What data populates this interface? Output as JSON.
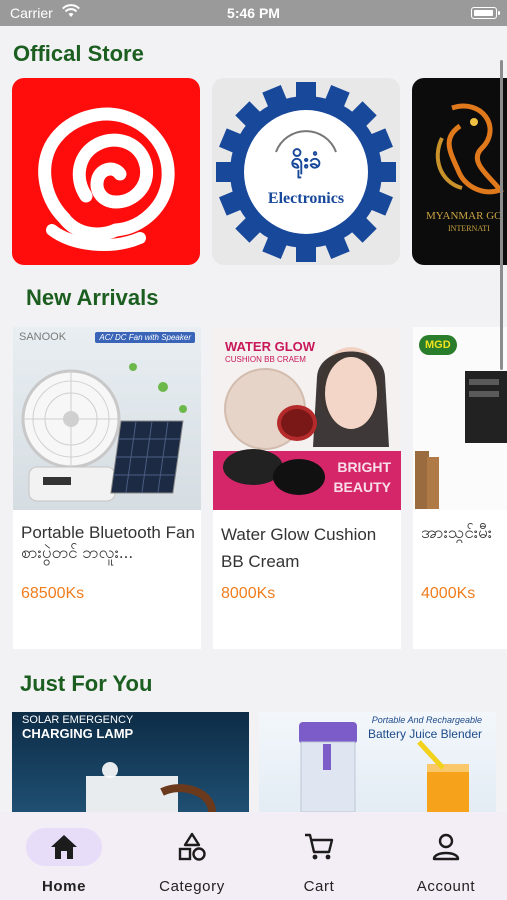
{
  "status_bar": {
    "carrier": "Carrier",
    "time": "5:46 PM"
  },
  "official_store": {
    "title": "Offical Store",
    "stores": [
      {
        "name": "rose-store"
      },
      {
        "name": "electronics-store",
        "logo_text": "ရိုးခံ",
        "logo_caption": "Electronics"
      },
      {
        "name": "myanmar-gold-store",
        "logo_text": "MYANMAR GO",
        "logo_caption": "INTERNATI"
      }
    ]
  },
  "new_arrivals": {
    "title": "New Arrivals",
    "products": [
      {
        "image_brand": "SANOOK",
        "image_banner": "AC/ DC Fan with Speaker",
        "name": "Portable Bluetooth Fan စားပွဲတင် ဘလူး...",
        "price": "68500Ks"
      },
      {
        "image_title": "WATER GLOW",
        "image_subtitle": "CUSHION BB CRAEM",
        "image_tag_1": "BRIGHT",
        "image_tag_2": "BEAUTY",
        "name": "Water Glow Cushion BB Cream",
        "price": "8000Ks"
      },
      {
        "image_brand": "MGD",
        "name": "အားသွင်းမီး",
        "price": "4000Ks"
      }
    ]
  },
  "just_for_you": {
    "title": "Just For You",
    "items": [
      {
        "caption_top": "SOLAR EMERGENCY",
        "caption_main": "CHARGING LAMP"
      },
      {
        "caption_top": "Portable And Rechargeable",
        "caption_main": "Battery Juice Blender"
      }
    ]
  },
  "bottom_nav": {
    "items": [
      {
        "label": "Home",
        "icon": "home-icon",
        "active": true
      },
      {
        "label": "Category",
        "icon": "category-icon",
        "active": false
      },
      {
        "label": "Cart",
        "icon": "cart-icon",
        "active": false
      },
      {
        "label": "Account",
        "icon": "account-icon",
        "active": false
      }
    ]
  },
  "colors": {
    "section_title": "#1b5e20",
    "price": "#f07d1d",
    "nav_active_pill": "#e8ddf8",
    "nav_background": "#f3edf6"
  }
}
